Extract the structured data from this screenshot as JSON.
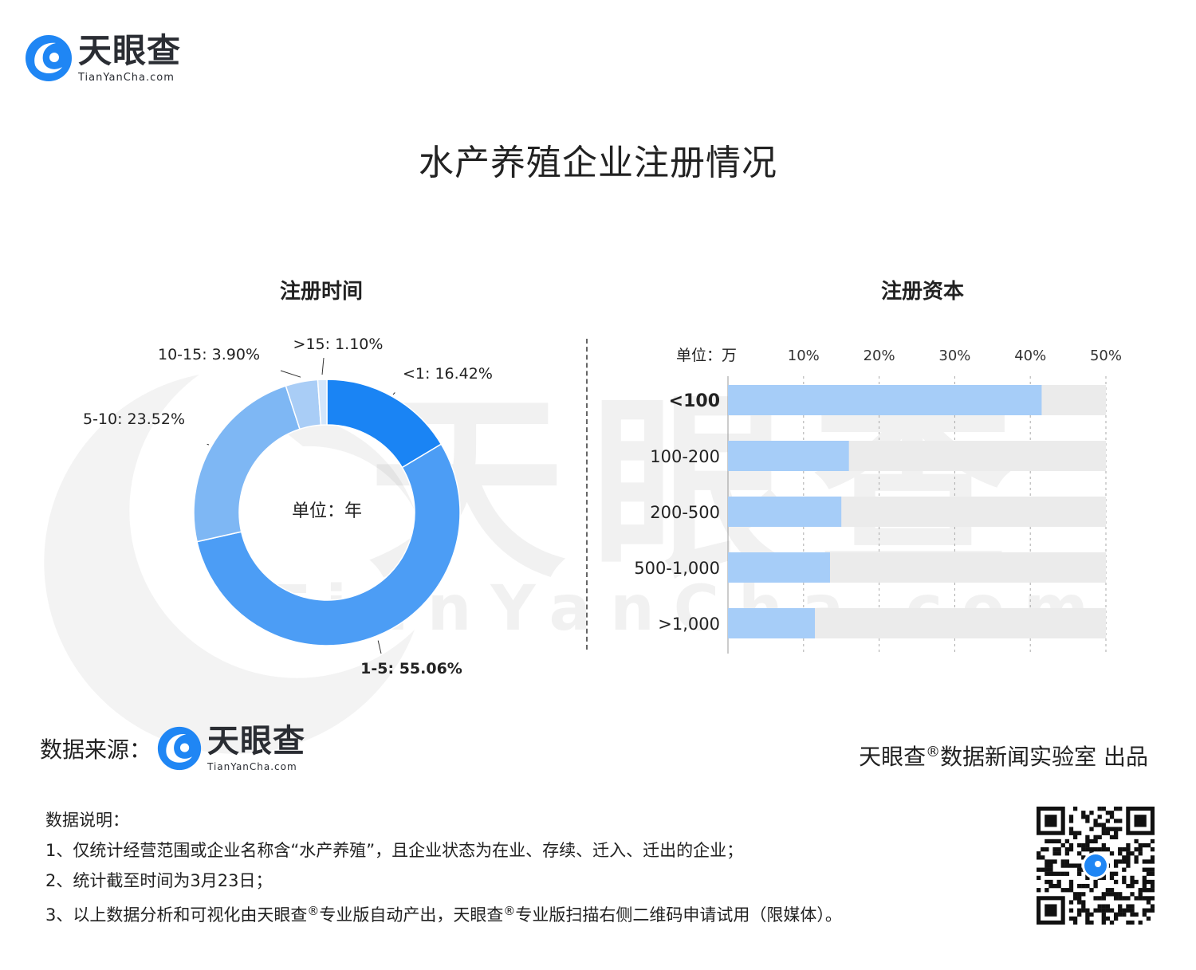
{
  "brand": {
    "name_cn": "天眼查",
    "name_en": "TianYanCha.com",
    "watermark_cn": "天眼查",
    "watermark_en": "TianYanCha.com"
  },
  "title": "水产养殖企业注册情况",
  "colors": {
    "pie": [
      "#1a84f4",
      "#4c9df5",
      "#7eb7f4",
      "#a9cdf6",
      "#d3e6fb"
    ],
    "bar": "#a6cdf8",
    "bar_track": "#ebebeb",
    "logo_blue": "#1f86f4"
  },
  "chart_data": [
    {
      "type": "pie",
      "title": "注册时间",
      "center_label": "单位：年",
      "slices": [
        {
          "label": "<1",
          "value": 16.42,
          "display": "<1: 16.42%"
        },
        {
          "label": "1-5",
          "value": 55.06,
          "display": "1-5: 55.06%"
        },
        {
          "label": "5-10",
          "value": 23.52,
          "display": "5-10: 23.52%"
        },
        {
          "label": "10-15",
          "value": 3.9,
          "display": "10-15: 3.90%"
        },
        {
          "label": ">15",
          "value": 1.1,
          "display": ">15: 1.10%"
        }
      ]
    },
    {
      "type": "bar",
      "orientation": "horizontal",
      "title": "注册资本",
      "unit_label": "单位：万",
      "categories": [
        "<100",
        "100-200",
        "200-500",
        "500-1,000",
        ">1,000"
      ],
      "values": [
        41.5,
        16,
        15,
        13.5,
        11.5
      ],
      "xticks": [
        "10%",
        "20%",
        "30%",
        "40%",
        "50%"
      ],
      "xlim": [
        0,
        50
      ],
      "grid": true,
      "highlight_category": "<100"
    }
  ],
  "footer": {
    "source_label": "数据来源：",
    "producer_prefix": "天眼查",
    "producer_mark": "®",
    "producer_suffix": "数据新闻实验室 出品"
  },
  "notes": {
    "heading": "数据说明：",
    "line1": "1、仅统计经营范围或企业名称含“水产养殖”，且企业状态为在业、存续、迁入、迁出的企业；",
    "line2": "2、统计截至时间为3月23日；",
    "line3_a": "3、以上数据分析和可视化由天眼查",
    "line3_mark_a": "®",
    "line3_b": "专业版自动产出，天眼查",
    "line3_mark_b": "®",
    "line3_c": "专业版扫描右侧二维码申请试用（限媒体）。"
  }
}
